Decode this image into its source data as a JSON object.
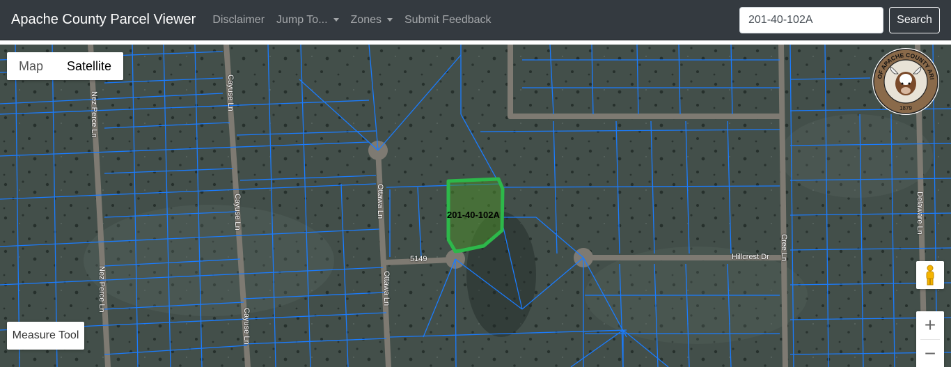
{
  "navbar": {
    "brand": "Apache County Parcel Viewer",
    "items": [
      "Disclaimer",
      "Jump To...",
      "Zones",
      "Submit Feedback"
    ],
    "search_value": "201-40-102A",
    "search_button": "Search"
  },
  "map": {
    "map_type": [
      "Map",
      "Satellite"
    ],
    "selected_map_type": "Satellite",
    "measure_tool": "Measure Tool",
    "zoom_in": "+",
    "zoom_out": "−",
    "parcel_label": "201-40-102A",
    "seal_text": "SEAL OF APACHE COUNTY ARIZONA",
    "seal_year": "1879",
    "roads": {
      "nez_perce_1": "Nez Perce Ln",
      "nez_perce_2": "Nez Perce Ln",
      "cayuse_1": "Cayuse Ln",
      "cayuse_2": "Cayuse Ln",
      "cayuse_3": "Cayuse Ln",
      "ottawa_1": "Ottawa Ln",
      "ottawa_2": "Ottawa Ln",
      "road_5149": "5149",
      "hillcrest": "Hillcrest Dr",
      "cree": "Cree Ln",
      "delaware": "Delaware Ln"
    },
    "colors": {
      "parcel_line": "#1a7cff",
      "selected_parcel": "#2db84a",
      "terrain": "#3d4a45"
    }
  }
}
